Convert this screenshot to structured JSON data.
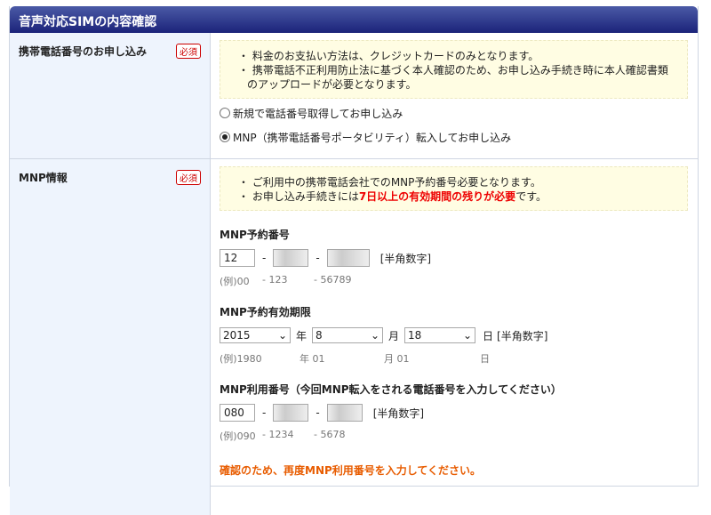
{
  "title": "音声対応SIMの内容確認",
  "required": "必須",
  "section1": {
    "label": "携帯電話番号のお申し込み",
    "notes": [
      "・ 料金のお支払い方法は、クレジットカードのみとなります。",
      "・ 携帯電話不正利用防止法に基づく本人確認のため、お申し込み手続き時に本人確認書類のアップロードが必要となります。"
    ],
    "options": [
      {
        "label": "新規で電話番号取得してお申し込み",
        "selected": false
      },
      {
        "label": "MNP（携帯電話番号ポータビリティ）転入してお申し込み",
        "selected": true
      }
    ]
  },
  "section2": {
    "label": "MNP情報",
    "note1": "・ ご利用中の携帯電話会社でのMNP予約番号必要となります。",
    "note2_pre": "・ お申し込み手続きには",
    "note2_red": "7日以上の有効期間の残りが必要",
    "note2_post": "です。",
    "reserve": {
      "label": "MNP予約番号",
      "v1": "12",
      "hint": "[半角数字]",
      "ex": [
        "(例)00",
        "- 123",
        "- 56789"
      ]
    },
    "expiry": {
      "label": "MNP予約有効期限",
      "year": "2015",
      "month": "8",
      "day": "18",
      "y": "年",
      "m": "月",
      "d": "日",
      "hint": "[半角数字]",
      "ex": [
        "(例)1980",
        "年 01",
        "月 01",
        "日"
      ]
    },
    "phone": {
      "label": "MNP利用番号（今回MNP転入をされる電話番号を入力してください）",
      "v1": "080",
      "hint": "[半角数字]",
      "ex": [
        "(例)090",
        "- 1234",
        "- 5678"
      ]
    },
    "confirm": "確認のため、再度MNP利用番号を入力してください。"
  }
}
